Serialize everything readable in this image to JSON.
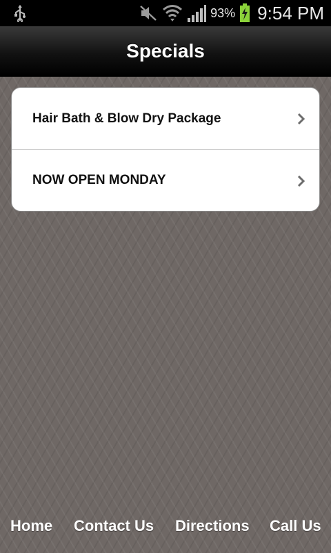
{
  "status_bar": {
    "battery_percent": "93%",
    "time": "9:54 PM",
    "icons": [
      "usb-icon",
      "mute-icon",
      "wifi-icon",
      "signal-icon",
      "battery-charging-icon"
    ]
  },
  "header": {
    "title": "Specials"
  },
  "specials": [
    {
      "label": "Hair Bath & Blow Dry Package"
    },
    {
      "label": "NOW OPEN MONDAY"
    }
  ],
  "nav": {
    "home": "Home",
    "contact": "Contact Us",
    "directions": "Directions",
    "call": "Call Us"
  },
  "colors": {
    "background": "#6f6865",
    "titlebar": "#121212",
    "list_bg": "#ffffff",
    "battery": "#8bd23a"
  }
}
